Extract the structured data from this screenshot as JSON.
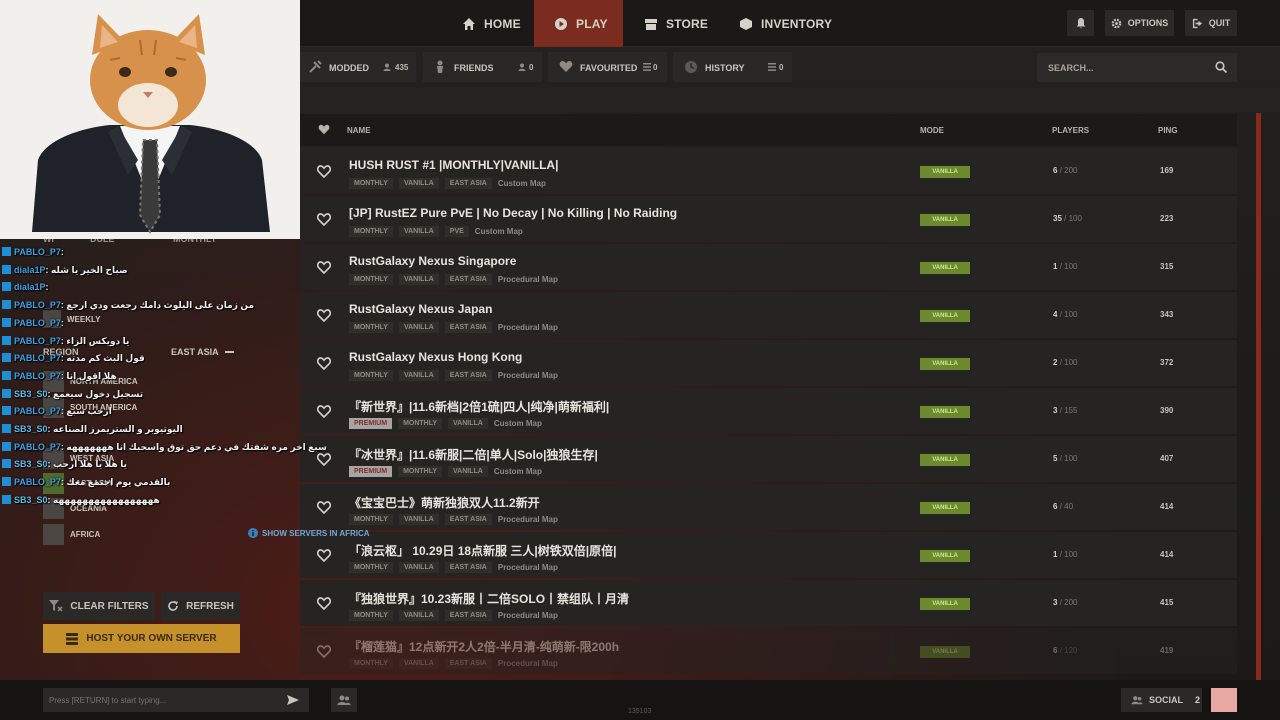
{
  "nav": {
    "tabs": [
      {
        "label": "HOME",
        "icon": "home-icon"
      },
      {
        "label": "PLAY",
        "icon": "play-icon",
        "active": true
      },
      {
        "label": "STORE",
        "icon": "store-icon"
      },
      {
        "label": "INVENTORY",
        "icon": "inventory-icon"
      }
    ],
    "options_label": "OPTIONS",
    "quit_label": "QUIT"
  },
  "filters": {
    "modded": {
      "label": "MODDED",
      "count": "435"
    },
    "friends": {
      "label": "FRIENDS",
      "count": "0"
    },
    "favourited": {
      "label": "FAVOURITED",
      "count": "0"
    },
    "history": {
      "label": "HISTORY",
      "count": "0"
    },
    "search_placeholder": "SEARCH..."
  },
  "table": {
    "headers": {
      "name": "NAME",
      "mode": "MODE",
      "players": "PLAYERS",
      "ping": "PING"
    },
    "rows": [
      {
        "name": "HUSH RUST #1 |MONTHLY|VANILLA|",
        "tags": [
          "MONTHLY",
          "VANILLA",
          "EAST ASIA"
        ],
        "map": "Custom Map",
        "mode": "VANILLA",
        "players": "6",
        "max": "/ 200",
        "ping": "169"
      },
      {
        "name": "[JP] RustEZ Pure PvE | No Decay | No Killing | No Raiding",
        "tags": [
          "MONTHLY",
          "VANILLA",
          "PVE"
        ],
        "map": "Custom Map",
        "mode": "VANILLA",
        "players": "35",
        "max": "/ 100",
        "ping": "223"
      },
      {
        "name": "RustGalaxy Nexus Singapore",
        "tags": [
          "MONTHLY",
          "VANILLA",
          "EAST ASIA"
        ],
        "map": "Procedural Map",
        "mode": "VANILLA",
        "players": "1",
        "max": "/ 100",
        "ping": "315"
      },
      {
        "name": "RustGalaxy Nexus Japan",
        "tags": [
          "MONTHLY",
          "VANILLA",
          "EAST ASIA"
        ],
        "map": "Procedural Map",
        "mode": "VANILLA",
        "players": "4",
        "max": "/ 100",
        "ping": "343"
      },
      {
        "name": "RustGalaxy Nexus Hong Kong",
        "tags": [
          "MONTHLY",
          "VANILLA",
          "EAST ASIA"
        ],
        "map": "Procedural Map",
        "mode": "VANILLA",
        "players": "2",
        "max": "/ 100",
        "ping": "372"
      },
      {
        "name": "『新世界』|11.6新档|2倍1硫|四人|纯净|萌新福利|",
        "premium": "PREMIUM",
        "tags": [
          "MONTHLY",
          "VANILLA"
        ],
        "map": "Custom Map",
        "mode": "VANILLA",
        "players": "3",
        "max": "/ 155",
        "ping": "390"
      },
      {
        "name": "『冰世界』|11.6新服|二倍|单人|Solo|独狼生存|",
        "premium": "PREMIUM",
        "tags": [
          "MONTHLY",
          "VANILLA"
        ],
        "map": "Custom Map",
        "mode": "VANILLA",
        "players": "5",
        "max": "/ 100",
        "ping": "407"
      },
      {
        "name": "《宝宝巴士》萌新独狼双人11.2新开",
        "tags": [
          "MONTHLY",
          "VANILLA",
          "EAST ASIA"
        ],
        "map": "Procedural Map",
        "mode": "VANILLA",
        "players": "6",
        "max": "/ 40",
        "ping": "414"
      },
      {
        "name": "「浪云枢」 10.29日 18点新服 三人|树铁双倍|原倍|",
        "tags": [
          "MONTHLY",
          "VANILLA",
          "EAST ASIA"
        ],
        "map": "Procedural Map",
        "mode": "VANILLA",
        "players": "1",
        "max": "/ 100",
        "ping": "414"
      },
      {
        "name": "『独狼世界』10.23新服丨二倍SOLO丨禁组队丨月清",
        "tags": [
          "MONTHLY",
          "VANILLA",
          "EAST ASIA"
        ],
        "map": "Procedural Map",
        "mode": "VANILLA",
        "players": "3",
        "max": "/ 200",
        "ping": "415"
      },
      {
        "name": "『榴莲猫』12点新开2人2倍-半月清-纯萌新-限200h",
        "tags": [
          "MONTHLY",
          "VANILLA",
          "EAST ASIA"
        ],
        "map": "Procedural Map",
        "mode": "VANILLA",
        "players": "6",
        "max": "/ 120",
        "ping": "419"
      }
    ]
  },
  "sidebar": {
    "partial_top": {
      "left": "WI",
      "mid": "DULE",
      "right": "MONTHLY"
    },
    "weekly_label": "WEEKLY",
    "region_label": "REGION",
    "region_value": "EAST ASIA",
    "regions": [
      "NORTH AMERICA",
      "SOUTH AMERICA",
      "WEST ASIA",
      "EAST ASIA",
      "OCEANIA",
      "AFRICA"
    ],
    "show_africa": "SHOW SERVERS IN AFRICA",
    "clear_filters": "CLEAR FILTERS",
    "refresh": "REFRESH",
    "host_server": "HOST YOUR OWN SERVER"
  },
  "chat_overlay": [
    {
      "user": "PABLO_P7",
      "text": ": "
    },
    {
      "user": "diala1P",
      "text": ": صباح الخير يا شله"
    },
    {
      "user": "diala1P",
      "text": ": "
    },
    {
      "user": "PABLO_P7",
      "text": ": من زمان على اليلوث دامك رجعت ودي ارجع"
    },
    {
      "user": "PABLO_P7",
      "text": ": "
    },
    {
      "user": "PABLO_P7",
      "text": ": يا دويكس الزاء"
    },
    {
      "user": "PABLO_P7",
      "text": ": قول البث كم مدته"
    },
    {
      "user": "PABLO_P7",
      "text": ": هلا اقول انا"
    },
    {
      "user": "SB3_S0",
      "text": ": تسجيل دخول سيعمع"
    },
    {
      "user": "PABLO_P7",
      "text": ": ارحب سبع"
    },
    {
      "user": "SB3_S0",
      "text": ": اليوتيوبر و الستريمرز الصناعه"
    },
    {
      "user": "PABLO_P7",
      "text": ": سبع اخر مره شفتك في دعم حق توق واسحبك انا هههههههه"
    },
    {
      "user": "SB3_S0",
      "text": ": يا هلا يا هلا ارحب"
    },
    {
      "user": "PABLO_P7",
      "text": ": بالقدمي يوم اجتمع معك"
    },
    {
      "user": "SB3_S0",
      "text": ": هههههههههههههههههه"
    }
  ],
  "bottom": {
    "chat_placeholder": "Press [RETURN] to start typing...",
    "social_label": "SOCIAL",
    "social_count": "2",
    "build": "135103"
  },
  "colors": {
    "accent_red": "#7c2c1f",
    "vanilla_green": "#6b8a2e",
    "host_yellow": "#c6902b",
    "twitch_blue": "#3aa4e8"
  }
}
